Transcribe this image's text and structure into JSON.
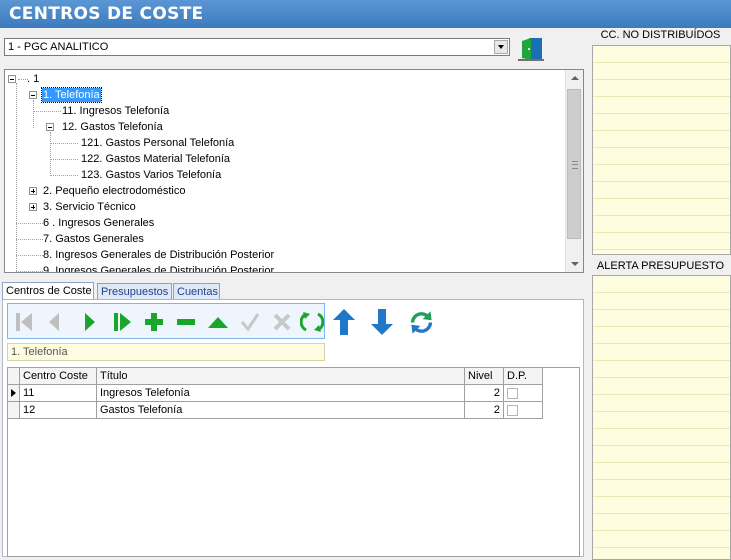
{
  "window": {
    "title": "CENTROS DE COSTE"
  },
  "plan_select": {
    "value": "1 - PGC ANALITICO"
  },
  "icons": {
    "exit": "exit-door-icon"
  },
  "tree": {
    "root": ". 1",
    "nodes": [
      {
        "label": "1. Telefonía",
        "selected": true
      },
      {
        "label": "11. Ingresos Telefonía"
      },
      {
        "label": "12. Gastos Telefonía"
      },
      {
        "label": "121. Gastos Personal Telefonía"
      },
      {
        "label": "122. Gastos Material Telefonía"
      },
      {
        "label": "123. Gastos Varios Telefonía"
      },
      {
        "label": "2. Pequeño electrodoméstico"
      },
      {
        "label": "3. Servicio Técnico"
      },
      {
        "label": "6 . Ingresos Generales"
      },
      {
        "label": "7. Gastos Generales"
      },
      {
        "label": "8. Ingresos Generales de Distribución Posterior"
      },
      {
        "label": "9. Ingresos Generales de Distribución Posterior"
      }
    ]
  },
  "tabs": [
    {
      "label": "Centros de Coste",
      "active": true
    },
    {
      "label": "Presupuestos"
    },
    {
      "label": "Cuentas"
    }
  ],
  "toolbar": {
    "buttons": [
      "first-icon",
      "prev-icon",
      "next-icon",
      "last-icon",
      "add-icon",
      "delete-icon",
      "up-icon",
      "confirm-icon",
      "cancel-icon",
      "refresh-icon",
      "move-up-icon",
      "move-down-icon",
      "sync-icon"
    ]
  },
  "current": {
    "label": "1. Telefonía"
  },
  "grid": {
    "columns": [
      "Centro Coste",
      "Título",
      "Nivel",
      "D.P."
    ],
    "rows": [
      {
        "centro": "11",
        "titulo": "Ingresos Telefonía",
        "nivel": "2",
        "dp": false
      },
      {
        "centro": "12",
        "titulo": "Gastos Telefonía",
        "nivel": "2",
        "dp": false
      }
    ]
  },
  "right_panel": {
    "undistributed_title": "CC. NO DISTRIBUÍDOS",
    "budget_alert_title": "ALERTA PRESUPUESTO"
  },
  "colors": {
    "titlebar": "#4a89c8",
    "selection": "#3399ff",
    "notes_bg": "#fffde0",
    "green": "#1aa62a",
    "blue": "#1f78c8"
  }
}
